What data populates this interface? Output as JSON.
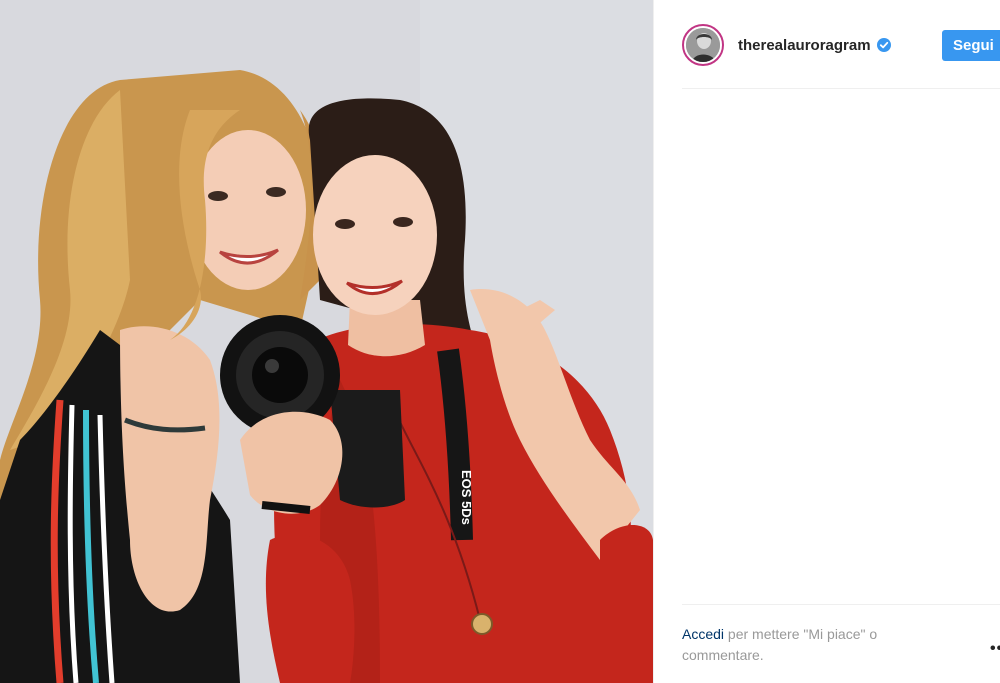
{
  "post": {
    "username": "therealauroragram",
    "verified": true,
    "follow_label": "Segui",
    "login_link": "Accedi",
    "login_rest": " per mettere \"Mi piace\" o commentare.",
    "more_icon": "more-dots-icon",
    "camera_text": "EOS 5Ds"
  },
  "colors": {
    "follow_button": "#3897f0",
    "link": "#003569",
    "muted_text": "#999999",
    "verified_badge": "#3897f0"
  }
}
